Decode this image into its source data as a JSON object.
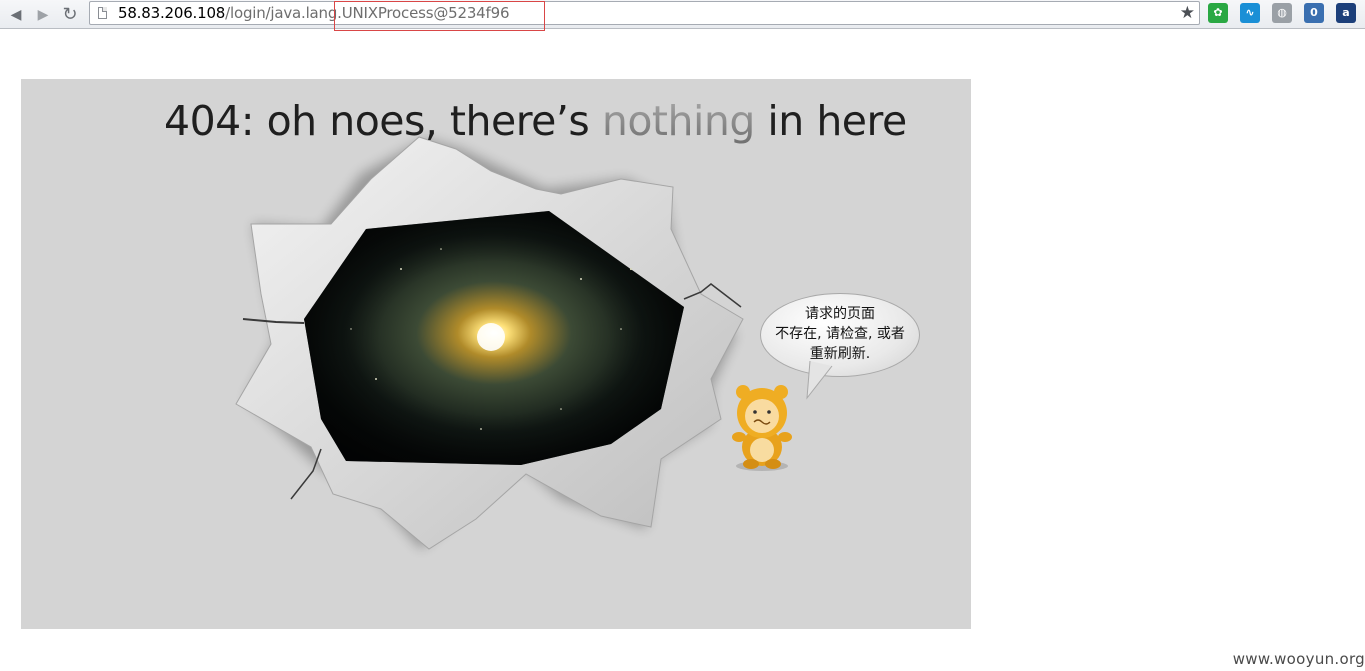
{
  "browser": {
    "back_label": "◀",
    "forward_label": "▶",
    "reload_label": "↻",
    "url_host": "58.83.206.108",
    "url_path": "/login/java.lang.UNIXProcess@5234f96",
    "bookmark_label": "★",
    "extensions": [
      {
        "name": "green-extension-icon",
        "glyph": "✿",
        "color": "#2aa843"
      },
      {
        "name": "wave-extension-icon",
        "glyph": "∿",
        "color": "#1a8fd6"
      },
      {
        "name": "globe-extension-icon",
        "glyph": "◍",
        "color": "#9aa0a6"
      },
      {
        "name": "counter-extension-icon",
        "glyph": "0",
        "color": "#3a6fb0"
      },
      {
        "name": "translate-extension-icon",
        "glyph": "a",
        "color": "#1c3f7a"
      }
    ]
  },
  "page": {
    "headline_start": "404: oh noes, there’s ",
    "headline_emphasis": "nothing",
    "headline_end": " in here",
    "bubble_lines": [
      "请求的页面",
      "不存在, 请检查, 或者",
      "重新刷新."
    ]
  },
  "watermark": "www.wooyun.org"
}
